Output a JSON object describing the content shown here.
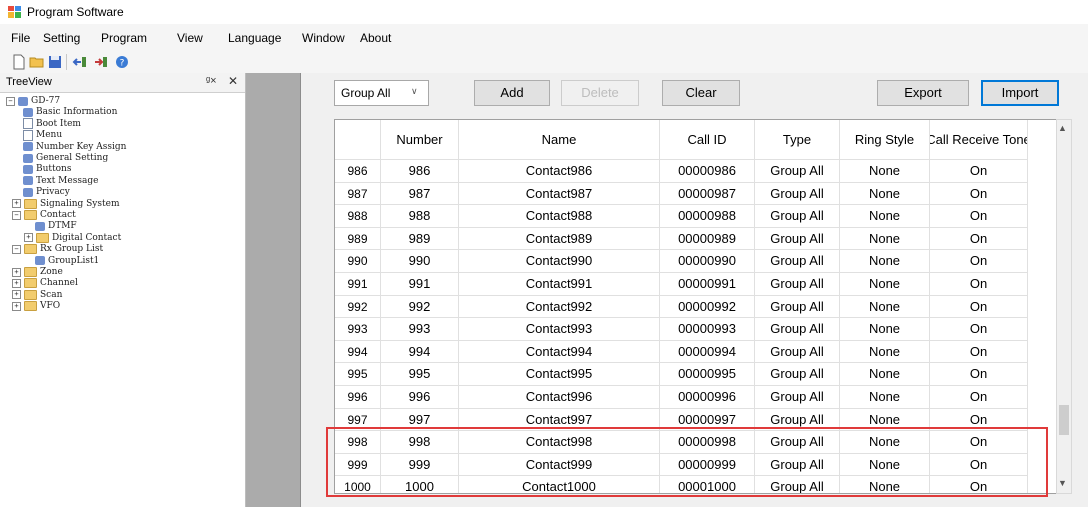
{
  "window": {
    "title": "Program Software"
  },
  "menu": [
    "File",
    "Setting",
    "Program",
    "View",
    "Language",
    "Window",
    "About"
  ],
  "toolbar": [
    "new-file-icon",
    "open-folder-icon",
    "save-icon",
    "read-from-radio-icon",
    "write-to-radio-icon",
    "help-icon"
  ],
  "tree": {
    "header": "TreeView",
    "items": [
      {
        "label": "GD-77",
        "icon": "radio-icon",
        "level": 0,
        "exp": "−"
      },
      {
        "label": "Basic Information",
        "icon": "info-icon",
        "level": 1
      },
      {
        "label": "Boot Item",
        "icon": "doc-icon",
        "level": 1
      },
      {
        "label": "Menu",
        "icon": "menu-icon",
        "level": 1
      },
      {
        "label": "Number Key Assign",
        "icon": "keypad-icon",
        "level": 1
      },
      {
        "label": "General Setting",
        "icon": "settings-icon",
        "level": 1
      },
      {
        "label": "Buttons",
        "icon": "buttons-icon",
        "level": 1
      },
      {
        "label": "Text Message",
        "icon": "message-icon",
        "level": 1
      },
      {
        "label": "Privacy",
        "icon": "privacy-icon",
        "level": 1
      },
      {
        "label": "Signaling System",
        "icon": "folder-icon",
        "level": 1,
        "exp": "+"
      },
      {
        "label": "Contact",
        "icon": "folder-icon",
        "level": 1,
        "exp": "−"
      },
      {
        "label": "DTMF",
        "icon": "contact-icon",
        "level": 2
      },
      {
        "label": "Digital Contact",
        "icon": "folder-icon",
        "level": 2,
        "exp": "+"
      },
      {
        "label": "Rx Group List",
        "icon": "folder-icon",
        "level": 1,
        "exp": "−"
      },
      {
        "label": "GroupList1",
        "icon": "group-icon",
        "level": 2
      },
      {
        "label": "Zone",
        "icon": "folder-icon",
        "level": 1,
        "exp": "+"
      },
      {
        "label": "Channel",
        "icon": "folder-icon",
        "level": 1,
        "exp": "+"
      },
      {
        "label": "Scan",
        "icon": "folder-icon",
        "level": 1,
        "exp": "+"
      },
      {
        "label": "VFO",
        "icon": "folder-icon",
        "level": 1,
        "exp": "+"
      }
    ]
  },
  "controls": {
    "group_select": "Group All",
    "add": "Add",
    "delete": "Delete",
    "clear": "Clear",
    "export": "Export",
    "import": "Import"
  },
  "table": {
    "columns": [
      "Number",
      "Name",
      "Call ID",
      "Type",
      "Ring Style",
      "Call Receive Tone"
    ],
    "rows": [
      {
        "row": "986",
        "number": "986",
        "name": "Contact986",
        "call_id": "00000986",
        "type": "Group All",
        "ring": "None",
        "tone": "On"
      },
      {
        "row": "987",
        "number": "987",
        "name": "Contact987",
        "call_id": "00000987",
        "type": "Group All",
        "ring": "None",
        "tone": "On"
      },
      {
        "row": "988",
        "number": "988",
        "name": "Contact988",
        "call_id": "00000988",
        "type": "Group All",
        "ring": "None",
        "tone": "On"
      },
      {
        "row": "989",
        "number": "989",
        "name": "Contact989",
        "call_id": "00000989",
        "type": "Group All",
        "ring": "None",
        "tone": "On"
      },
      {
        "row": "990",
        "number": "990",
        "name": "Contact990",
        "call_id": "00000990",
        "type": "Group All",
        "ring": "None",
        "tone": "On"
      },
      {
        "row": "991",
        "number": "991",
        "name": "Contact991",
        "call_id": "00000991",
        "type": "Group All",
        "ring": "None",
        "tone": "On"
      },
      {
        "row": "992",
        "number": "992",
        "name": "Contact992",
        "call_id": "00000992",
        "type": "Group All",
        "ring": "None",
        "tone": "On"
      },
      {
        "row": "993",
        "number": "993",
        "name": "Contact993",
        "call_id": "00000993",
        "type": "Group All",
        "ring": "None",
        "tone": "On"
      },
      {
        "row": "994",
        "number": "994",
        "name": "Contact994",
        "call_id": "00000994",
        "type": "Group All",
        "ring": "None",
        "tone": "On"
      },
      {
        "row": "995",
        "number": "995",
        "name": "Contact995",
        "call_id": "00000995",
        "type": "Group All",
        "ring": "None",
        "tone": "On"
      },
      {
        "row": "996",
        "number": "996",
        "name": "Contact996",
        "call_id": "00000996",
        "type": "Group All",
        "ring": "None",
        "tone": "On"
      },
      {
        "row": "997",
        "number": "997",
        "name": "Contact997",
        "call_id": "00000997",
        "type": "Group All",
        "ring": "None",
        "tone": "On"
      },
      {
        "row": "998",
        "number": "998",
        "name": "Contact998",
        "call_id": "00000998",
        "type": "Group All",
        "ring": "None",
        "tone": "On"
      },
      {
        "row": "999",
        "number": "999",
        "name": "Contact999",
        "call_id": "00000999",
        "type": "Group All",
        "ring": "None",
        "tone": "On"
      },
      {
        "row": "1000",
        "number": "1000",
        "name": "Contact1000",
        "call_id": "00001000",
        "type": "Group All",
        "ring": "None",
        "tone": "On"
      }
    ]
  },
  "colors": {
    "highlight": "#e03a3a",
    "import_border": "#0078d7"
  }
}
